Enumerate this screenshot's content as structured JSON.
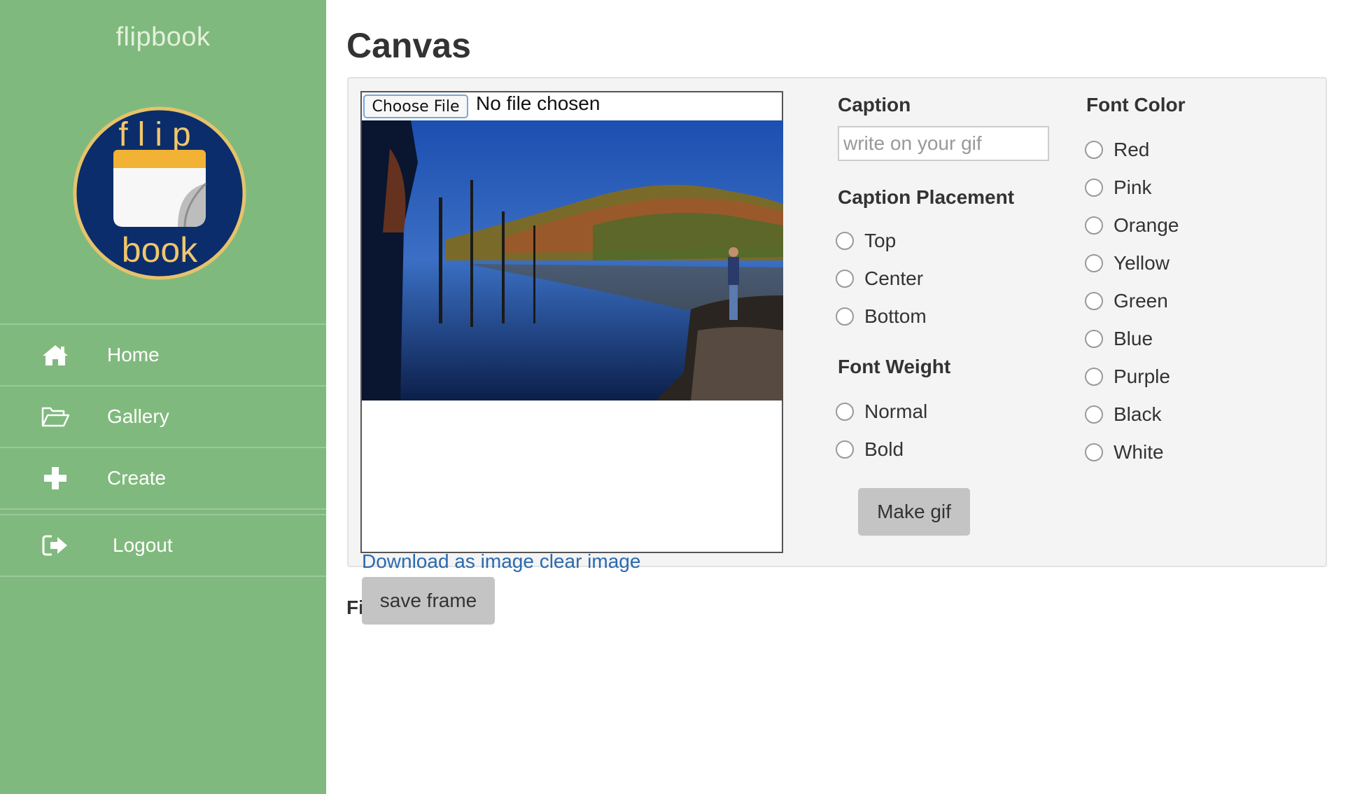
{
  "sidebar": {
    "brand": "flipbook",
    "logo": {
      "top_text": "flip",
      "bottom_text": "book",
      "colors": {
        "circle": "#0b2d6b",
        "ring": "#e6c36a",
        "text": "#f1c66b"
      }
    },
    "items": [
      {
        "label": "Home",
        "icon": "home-icon"
      },
      {
        "label": "Gallery",
        "icon": "folder-open-icon"
      },
      {
        "label": "Create",
        "icon": "plus-icon"
      },
      {
        "label": "Logout",
        "icon": "logout-icon"
      }
    ]
  },
  "main": {
    "title": "Canvas",
    "file_input": {
      "button_label": "Choose File",
      "status": "No file chosen"
    },
    "links": {
      "download": "Download as image",
      "clear": "clear image"
    },
    "frames_label": "Fi",
    "save_frame_label": "save frame",
    "caption": {
      "label": "Caption",
      "placeholder": "write on your gif"
    },
    "caption_placement": {
      "label": "Caption Placement",
      "options": [
        "Top",
        "Center",
        "Bottom"
      ]
    },
    "font_weight": {
      "label": "Font Weight",
      "options": [
        "Normal",
        "Bold"
      ]
    },
    "font_color": {
      "label": "Font Color",
      "options": [
        "Red",
        "Pink",
        "Orange",
        "Yellow",
        "Green",
        "Blue",
        "Purple",
        "Black",
        "White"
      ]
    },
    "make_gif_label": "Make gif"
  },
  "colors": {
    "sidebar": "#80b97d",
    "link": "#2a6ab0",
    "button": "#c4c4c4",
    "panel": "#f4f4f4"
  }
}
